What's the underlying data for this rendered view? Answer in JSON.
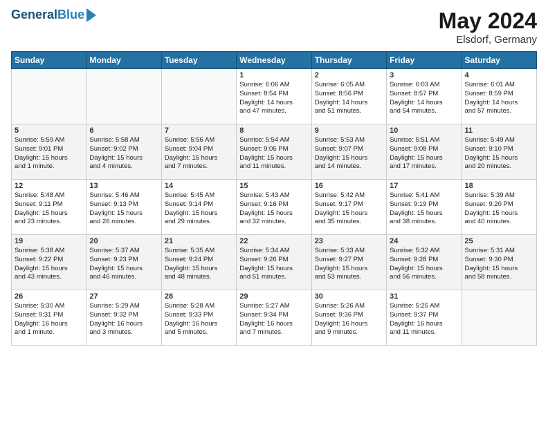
{
  "logo": {
    "line1": "General",
    "line2": "Blue"
  },
  "header": {
    "month": "May 2024",
    "location": "Elsdorf, Germany"
  },
  "weekdays": [
    "Sunday",
    "Monday",
    "Tuesday",
    "Wednesday",
    "Thursday",
    "Friday",
    "Saturday"
  ],
  "weeks": [
    [
      {
        "day": "",
        "info": ""
      },
      {
        "day": "",
        "info": ""
      },
      {
        "day": "",
        "info": ""
      },
      {
        "day": "1",
        "info": "Sunrise: 6:06 AM\nSunset: 8:54 PM\nDaylight: 14 hours\nand 47 minutes."
      },
      {
        "day": "2",
        "info": "Sunrise: 6:05 AM\nSunset: 8:56 PM\nDaylight: 14 hours\nand 51 minutes."
      },
      {
        "day": "3",
        "info": "Sunrise: 6:03 AM\nSunset: 8:57 PM\nDaylight: 14 hours\nand 54 minutes."
      },
      {
        "day": "4",
        "info": "Sunrise: 6:01 AM\nSunset: 8:59 PM\nDaylight: 14 hours\nand 57 minutes."
      }
    ],
    [
      {
        "day": "5",
        "info": "Sunrise: 5:59 AM\nSunset: 9:01 PM\nDaylight: 15 hours\nand 1 minute."
      },
      {
        "day": "6",
        "info": "Sunrise: 5:58 AM\nSunset: 9:02 PM\nDaylight: 15 hours\nand 4 minutes."
      },
      {
        "day": "7",
        "info": "Sunrise: 5:56 AM\nSunset: 9:04 PM\nDaylight: 15 hours\nand 7 minutes."
      },
      {
        "day": "8",
        "info": "Sunrise: 5:54 AM\nSunset: 9:05 PM\nDaylight: 15 hours\nand 11 minutes."
      },
      {
        "day": "9",
        "info": "Sunrise: 5:53 AM\nSunset: 9:07 PM\nDaylight: 15 hours\nand 14 minutes."
      },
      {
        "day": "10",
        "info": "Sunrise: 5:51 AM\nSunset: 9:08 PM\nDaylight: 15 hours\nand 17 minutes."
      },
      {
        "day": "11",
        "info": "Sunrise: 5:49 AM\nSunset: 9:10 PM\nDaylight: 15 hours\nand 20 minutes."
      }
    ],
    [
      {
        "day": "12",
        "info": "Sunrise: 5:48 AM\nSunset: 9:11 PM\nDaylight: 15 hours\nand 23 minutes."
      },
      {
        "day": "13",
        "info": "Sunrise: 5:46 AM\nSunset: 9:13 PM\nDaylight: 15 hours\nand 26 minutes."
      },
      {
        "day": "14",
        "info": "Sunrise: 5:45 AM\nSunset: 9:14 PM\nDaylight: 15 hours\nand 29 minutes."
      },
      {
        "day": "15",
        "info": "Sunrise: 5:43 AM\nSunset: 9:16 PM\nDaylight: 15 hours\nand 32 minutes."
      },
      {
        "day": "16",
        "info": "Sunrise: 5:42 AM\nSunset: 9:17 PM\nDaylight: 15 hours\nand 35 minutes."
      },
      {
        "day": "17",
        "info": "Sunrise: 5:41 AM\nSunset: 9:19 PM\nDaylight: 15 hours\nand 38 minutes."
      },
      {
        "day": "18",
        "info": "Sunrise: 5:39 AM\nSunset: 9:20 PM\nDaylight: 15 hours\nand 40 minutes."
      }
    ],
    [
      {
        "day": "19",
        "info": "Sunrise: 5:38 AM\nSunset: 9:22 PM\nDaylight: 15 hours\nand 43 minutes."
      },
      {
        "day": "20",
        "info": "Sunrise: 5:37 AM\nSunset: 9:23 PM\nDaylight: 15 hours\nand 46 minutes."
      },
      {
        "day": "21",
        "info": "Sunrise: 5:35 AM\nSunset: 9:24 PM\nDaylight: 15 hours\nand 48 minutes."
      },
      {
        "day": "22",
        "info": "Sunrise: 5:34 AM\nSunset: 9:26 PM\nDaylight: 15 hours\nand 51 minutes."
      },
      {
        "day": "23",
        "info": "Sunrise: 5:33 AM\nSunset: 9:27 PM\nDaylight: 15 hours\nand 53 minutes."
      },
      {
        "day": "24",
        "info": "Sunrise: 5:32 AM\nSunset: 9:28 PM\nDaylight: 15 hours\nand 56 minutes."
      },
      {
        "day": "25",
        "info": "Sunrise: 5:31 AM\nSunset: 9:30 PM\nDaylight: 15 hours\nand 58 minutes."
      }
    ],
    [
      {
        "day": "26",
        "info": "Sunrise: 5:30 AM\nSunset: 9:31 PM\nDaylight: 16 hours\nand 1 minute."
      },
      {
        "day": "27",
        "info": "Sunrise: 5:29 AM\nSunset: 9:32 PM\nDaylight: 16 hours\nand 3 minutes."
      },
      {
        "day": "28",
        "info": "Sunrise: 5:28 AM\nSunset: 9:33 PM\nDaylight: 16 hours\nand 5 minutes."
      },
      {
        "day": "29",
        "info": "Sunrise: 5:27 AM\nSunset: 9:34 PM\nDaylight: 16 hours\nand 7 minutes."
      },
      {
        "day": "30",
        "info": "Sunrise: 5:26 AM\nSunset: 9:36 PM\nDaylight: 16 hours\nand 9 minutes."
      },
      {
        "day": "31",
        "info": "Sunrise: 5:25 AM\nSunset: 9:37 PM\nDaylight: 16 hours\nand 11 minutes."
      },
      {
        "day": "",
        "info": ""
      }
    ]
  ]
}
